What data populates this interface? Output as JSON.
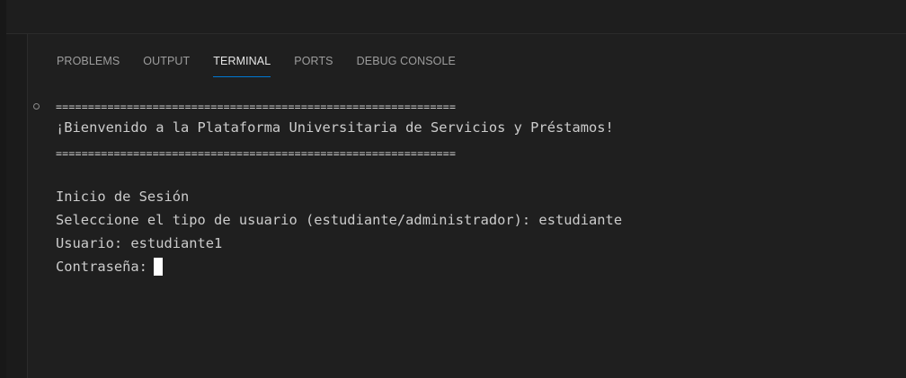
{
  "panel": {
    "tabs": [
      {
        "label": "PROBLEMS"
      },
      {
        "label": "OUTPUT"
      },
      {
        "label": "TERMINAL"
      },
      {
        "label": "PORTS"
      },
      {
        "label": "DEBUG CONSOLE"
      }
    ],
    "active_tab": "TERMINAL"
  },
  "terminal": {
    "separator_top": "==============================================================",
    "welcome": "¡Bienvenido a la Plataforma Universitaria de Servicios y Préstamos!",
    "separator_bottom": "==============================================================",
    "login_heading": "Inicio de Sesión",
    "user_type_prompt": "Seleccione el tipo de usuario (estudiante/administrador): estudiante",
    "username_prompt": "Usuario: estudiante1",
    "password_prompt": "Contraseña:"
  },
  "colors": {
    "background": "#1f1f1f",
    "active_tab_underline": "#0078d4",
    "terminal_text": "#cccccc"
  }
}
